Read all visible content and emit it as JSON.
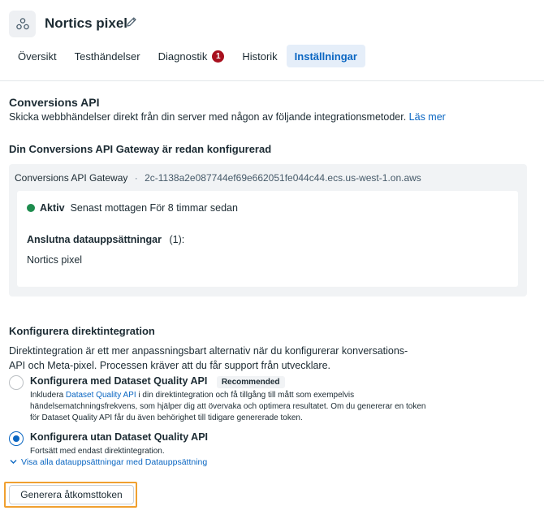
{
  "header": {
    "title": "Nortics pixel",
    "tabs": [
      {
        "label": "Översikt"
      },
      {
        "label": "Testhändelser"
      },
      {
        "label": "Diagnostik",
        "badge": "1"
      },
      {
        "label": "Historik"
      },
      {
        "label": "Inställningar",
        "active": true
      }
    ]
  },
  "conversions_api": {
    "heading": "Conversions API",
    "description": "Skicka webbhändelser direkt från din server med någon av följande integrationsmetoder.",
    "link": "Läs mer"
  },
  "gateway": {
    "heading": "Din Conversions API Gateway är redan konfigurerad",
    "name": "Conversions API Gateway",
    "separator": "·",
    "id": "2c-1138a2e087744ef69e662051fe044c44.ecs.us-west-1.on.aws",
    "status": "Aktiv",
    "status_detail": "Senast mottagen För 8 timmar sedan",
    "connected_heading": "Anslutna datauppsättningar",
    "connected_count": "(1):",
    "connected_value": "Nortics pixel"
  },
  "direct": {
    "heading": "Konfigurera direktintegration",
    "description": "Direktintegration är ett mer anpassningsbart alternativ när du konfigurerar konversations-API och Meta-pixel. Processen kräver att du får support från utvecklare.",
    "options": [
      {
        "title": "Konfigurera med Dataset Quality API",
        "badge": "Recommended",
        "desc_prefix": "Inkludera ",
        "desc_link": "Dataset Quality API",
        "desc_suffix": " i din direktintegration och få tillgång till mått som exempelvis händelsematchningsfrekvens, som hjälper dig att övervaka och optimera resultatet. Om du genererar en token för Dataset Quality API får du även behörighet till tidigare genererade token.",
        "checked": false
      },
      {
        "title": "Konfigurera utan Dataset Quality API",
        "desc": "Fortsätt med endast direktintegration.",
        "checked": true
      }
    ],
    "view_all": "Visa alla datauppsättningar med Datauppsättning",
    "generate_button": "Generera åtkomsttoken"
  },
  "colors": {
    "accent": "#0a66c2",
    "active_status": "#1e8c4e",
    "badge": "#a8101e",
    "focus_ring": "#f0a030"
  },
  "icons": {
    "pixel": "pixel-icon",
    "edit": "pencil-icon",
    "status": "status-dot-icon",
    "expand": "chevron-down-icon"
  }
}
